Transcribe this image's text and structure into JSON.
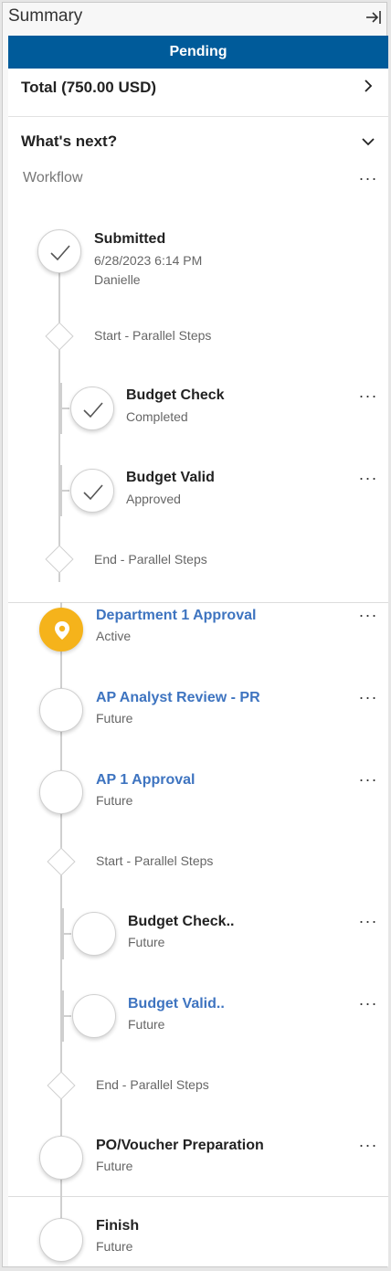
{
  "header": {
    "title": "Summary",
    "collapse_icon": "collapse-right-icon"
  },
  "status": {
    "label": "Pending",
    "color": "#005b9a"
  },
  "total": {
    "label": "Total (750.00 USD)"
  },
  "whats_next": {
    "label": "What's next?"
  },
  "workflow": {
    "label": "Workflow"
  },
  "steps": {
    "submitted": {
      "title": "Submitted",
      "date": "6/28/2023 6:14 PM",
      "user": "Danielle"
    },
    "start1": {
      "label": "Start - Parallel Steps"
    },
    "budget_check": {
      "title": "Budget Check",
      "status": "Completed"
    },
    "budget_valid": {
      "title": "Budget Valid",
      "status": "Approved"
    },
    "end1": {
      "label": "End - Parallel Steps"
    },
    "dept_approval": {
      "title": "Department 1 Approval",
      "status": "Active"
    },
    "ap_analyst": {
      "title": "AP Analyst Review - PR",
      "status": "Future"
    },
    "ap_approval": {
      "title": "AP 1 Approval",
      "status": "Future"
    },
    "start2": {
      "label": "Start - Parallel Steps"
    },
    "budget_check2": {
      "title": "Budget Check..",
      "status": "Future"
    },
    "budget_valid2": {
      "title": "Budget Valid..",
      "status": "Future"
    },
    "end2": {
      "label": "End - Parallel Steps"
    },
    "po_voucher": {
      "title": "PO/Voucher Preparation",
      "status": "Future"
    },
    "finish": {
      "title": "Finish",
      "status": "Future"
    }
  },
  "colors": {
    "link": "#3e74c0",
    "active": "#f5b31b"
  }
}
